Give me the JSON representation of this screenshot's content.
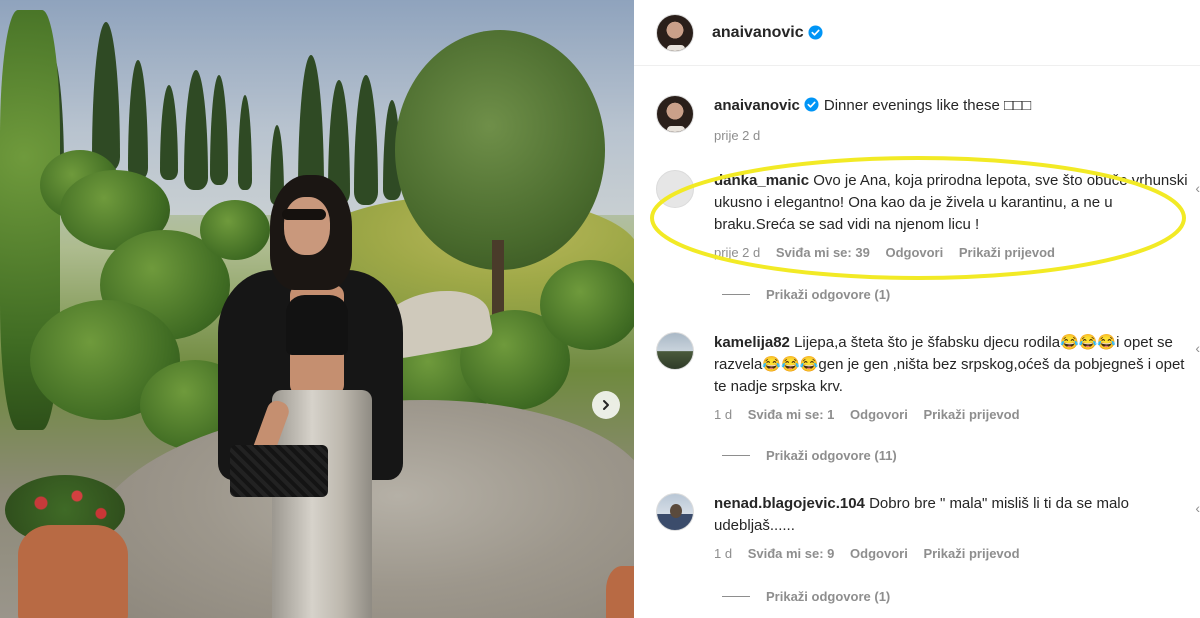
{
  "post": {
    "author": "anaivanovic",
    "caption": "Dinner evenings like these □□□",
    "time": "prije 2 d"
  },
  "comments": [
    {
      "username": "danka_manic",
      "text": "Ovo je Ana, koja prirodna lepota, sve što obuče vrhunski ukusno i elegantno! Ona kao da je živela u karantinu, a ne u braku.Sreća se sad vidi na njenom licu !",
      "time": "prije 2 d",
      "likes": "Sviđa mi se: 39",
      "reply": "Odgovori",
      "translate": "Prikaži prijevod",
      "view_replies": "Prikaži odgovore (1)"
    },
    {
      "username": "kamelija82",
      "text": "Lijepa,a šteta što je šfabsku djecu rodila😂😂😂i opet se razvela😂😂😂gen je gen ,ništa bez srpskog,oćeš da pobjegneš i opet te nadje srpska krv.",
      "time": "1 d",
      "likes": "Sviđa mi se: 1",
      "reply": "Odgovori",
      "translate": "Prikaži prijevod",
      "view_replies": "Prikaži odgovore (11)"
    },
    {
      "username": "nenad.blagojevic.104",
      "text": "Dobro bre \" mala\" misliš li ti da se malo udebljaš......",
      "time": "1 d",
      "likes": "Sviđa mi se: 9",
      "reply": "Odgovori",
      "translate": "Prikaži prijevod",
      "view_replies": "Prikaži odgovore (1)"
    }
  ],
  "colors": {
    "verified_blue": "#0095f6",
    "highlight_yellow": "#f2ea25",
    "meta_gray": "#8e8e8e"
  },
  "icons": [
    "verified-badge-icon",
    "chevron-right-icon"
  ]
}
